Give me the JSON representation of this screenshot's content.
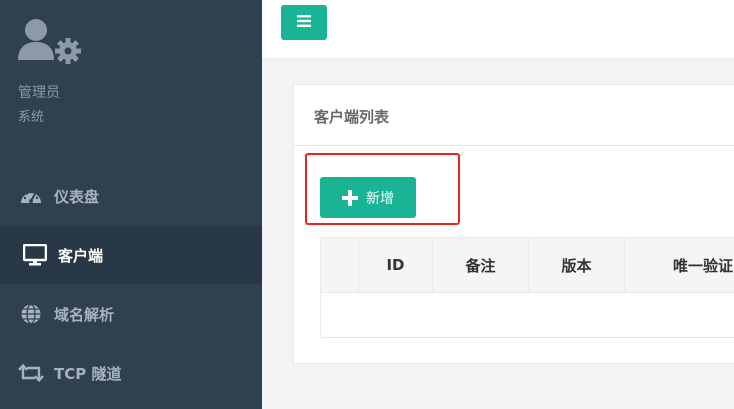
{
  "sidebar": {
    "user": {
      "name": "管理员",
      "role": "系统"
    },
    "items": [
      {
        "label": "仪表盘",
        "icon": "dashboard-icon",
        "active": false
      },
      {
        "label": "客户端",
        "icon": "monitor-icon",
        "active": true
      },
      {
        "label": "域名解析",
        "icon": "globe-icon",
        "active": false
      },
      {
        "label": "TCP 隧道",
        "icon": "retweet-icon",
        "active": false
      }
    ]
  },
  "topbar": {
    "toggle_icon": "hamburger-icon"
  },
  "panel": {
    "title": "客户端列表",
    "add_button_label": "新增"
  },
  "table": {
    "columns": [
      "",
      "ID",
      "备注",
      "版本",
      "唯一验证"
    ]
  },
  "colors": {
    "sidebar_bg": "#2f4050",
    "sidebar_active_bg": "#293846",
    "accent": "#1ab394",
    "highlight": "#e8241e"
  }
}
